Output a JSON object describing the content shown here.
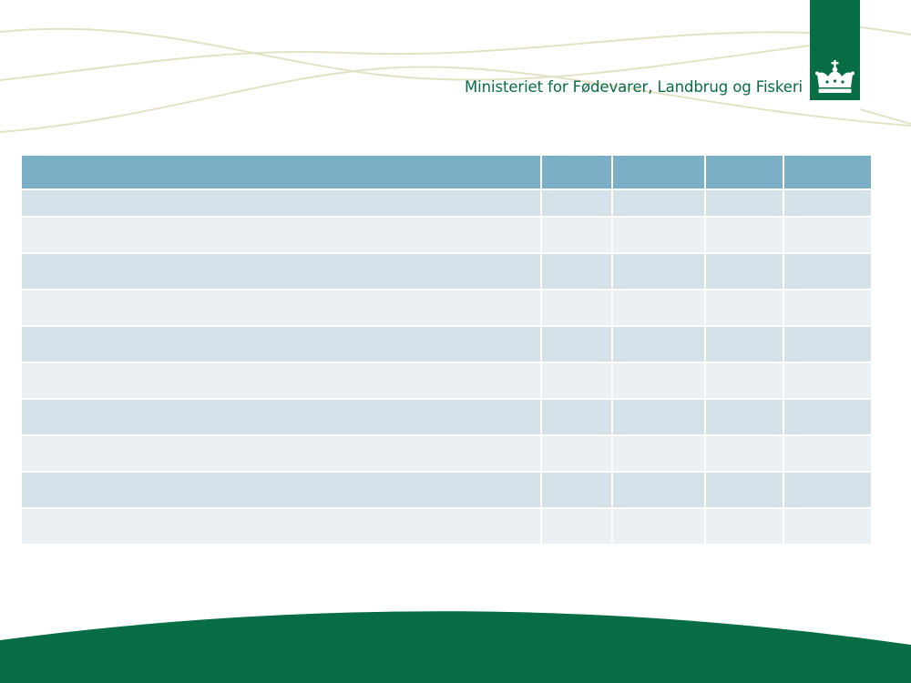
{
  "header": {
    "ministry_name": "Ministeriet for Fødevarer, Landbrug og Fiskeri",
    "logo": "royal-crown-icon",
    "brand_color": "#076d45",
    "wave_color": "#e4e2c6"
  },
  "table": {
    "header_color": "#7aafc5",
    "row_colors": [
      "#d6e2e9",
      "#ebf0f4"
    ],
    "columns": [
      "",
      "",
      "",
      "",
      ""
    ],
    "rows": [
      [
        "",
        "",
        "",
        "",
        ""
      ],
      [
        "",
        "",
        "",
        "",
        ""
      ],
      [
        "",
        "",
        "",
        "",
        ""
      ],
      [
        "",
        "",
        "",
        "",
        ""
      ],
      [
        "",
        "",
        "",
        "",
        ""
      ],
      [
        "",
        "",
        "",
        "",
        ""
      ],
      [
        "",
        "",
        "",
        "",
        ""
      ],
      [
        "",
        "",
        "",
        "",
        ""
      ],
      [
        "",
        "",
        "",
        "",
        ""
      ],
      [
        "",
        "",
        "",
        "",
        ""
      ]
    ]
  }
}
